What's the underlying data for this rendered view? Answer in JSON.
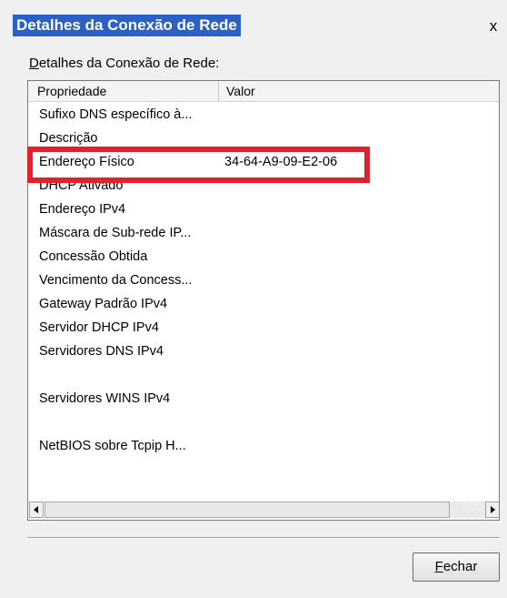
{
  "window": {
    "title": "Detalhes da Conexão de Rede",
    "close_label": "x"
  },
  "group": {
    "label_mnemonic": "D",
    "label_rest": "etalhes da Conexão de Rede:"
  },
  "table": {
    "columns": [
      "Propriedade",
      "Valor"
    ],
    "rows": [
      {
        "property": "Sufixo DNS específico à...",
        "value": ""
      },
      {
        "property": "Descrição",
        "value": ""
      },
      {
        "property": "Endereço Físico",
        "value": "34-64-A9-09-E2-06"
      },
      {
        "property": "DHCP Ativado",
        "value": ""
      },
      {
        "property": "Endereço IPv4",
        "value": ""
      },
      {
        "property": "Máscara de Sub-rede IP...",
        "value": ""
      },
      {
        "property": "Concessão Obtida",
        "value": ""
      },
      {
        "property": "Vencimento da Concess...",
        "value": ""
      },
      {
        "property": "Gateway Padrão IPv4",
        "value": ""
      },
      {
        "property": "Servidor DHCP IPv4",
        "value": ""
      },
      {
        "property": "Servidores DNS IPv4",
        "value": ""
      },
      {
        "property": "",
        "value": ""
      },
      {
        "property": "Servidores WINS IPv4",
        "value": ""
      },
      {
        "property": "",
        "value": ""
      },
      {
        "property": "NetBIOS sobre Tcpip H...",
        "value": ""
      }
    ]
  },
  "scrollbar": {
    "left_arrow_icon": "triangle-left-icon",
    "right_arrow_icon": "triangle-right-icon"
  },
  "buttons": {
    "close_mnemonic": "F",
    "close_rest": "echar"
  },
  "colors": {
    "title_highlight": "#2b61c5",
    "annotation_box": "#e3202c"
  }
}
